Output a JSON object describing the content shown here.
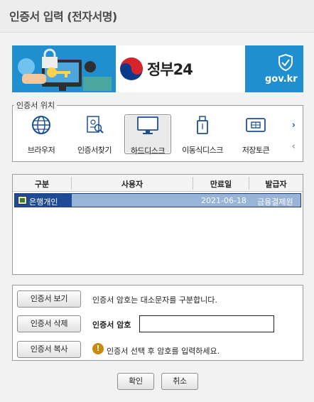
{
  "window": {
    "title": "인증서 입력 (전자서명)"
  },
  "banner": {
    "logo_text": "정부24",
    "domain_text": "gov.kr"
  },
  "location": {
    "label": "인증서 위치",
    "items": [
      {
        "label": "브라우저",
        "icon": "globe-icon"
      },
      {
        "label": "인증서찾기",
        "icon": "certificate-search-icon"
      },
      {
        "label": "하드디스크",
        "icon": "monitor-icon",
        "selected": true
      },
      {
        "label": "이동식디스크",
        "icon": "usb-icon"
      },
      {
        "label": "저장토큰",
        "icon": "token-card-icon"
      }
    ],
    "next_arrow": "›",
    "prev_arrow": "‹"
  },
  "table": {
    "columns": [
      "구분",
      "사용자",
      "만료일",
      "발급자"
    ],
    "rows": [
      {
        "type": "은행개인",
        "user": "",
        "expiry": "2021-06-18",
        "issuer": "금융결제원"
      }
    ]
  },
  "actions": {
    "view_label": "인증서 보기",
    "delete_label": "인증서 삭제",
    "copy_label": "인증서 복사",
    "case_note": "인증서 암호는 대소문자를 구분합니다.",
    "password_label": "인증서 암호",
    "password_value": "",
    "hint": "인증서 선택 후 암호를 입력하세요."
  },
  "footer": {
    "ok_label": "확인",
    "cancel_label": "취소"
  }
}
